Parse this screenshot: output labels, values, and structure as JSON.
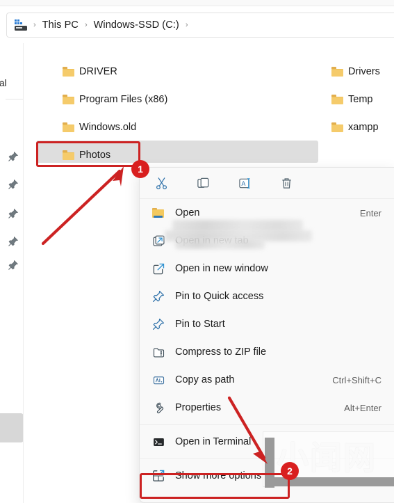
{
  "breadcrumb": {
    "icon": "this-pc-icon",
    "items": [
      "This PC",
      "Windows-SSD (C:)"
    ],
    "separator": "›"
  },
  "nav_pane": {
    "clipped_label": "onal",
    "pin_count": 5,
    "pin_icon": "pin-icon"
  },
  "file_list": {
    "left_column": [
      {
        "name": "DRIVER",
        "icon": "folder-icon"
      },
      {
        "name": "Program Files (x86)",
        "icon": "folder-icon"
      },
      {
        "name": "Windows.old",
        "icon": "folder-icon"
      },
      {
        "name": "Photos",
        "icon": "folder-icon",
        "selected": true
      }
    ],
    "right_column": [
      {
        "name": "Drivers",
        "icon": "folder-icon"
      },
      {
        "name": "Temp",
        "icon": "folder-icon"
      },
      {
        "name": "xampp",
        "icon": "folder-icon"
      }
    ]
  },
  "context_menu": {
    "toolbar": [
      {
        "name": "Cut",
        "icon": "scissors-icon"
      },
      {
        "name": "Copy",
        "icon": "copy-icon"
      },
      {
        "name": "Rename",
        "icon": "rename-icon"
      },
      {
        "name": "Delete",
        "icon": "trash-icon"
      }
    ],
    "items": [
      {
        "label": "Open",
        "accel": "Enter",
        "icon": "open-folder-icon"
      },
      {
        "label": "Open in new tab",
        "accel": "",
        "icon": "new-tab-icon"
      },
      {
        "label": "Open in new window",
        "accel": "",
        "icon": "new-window-icon"
      },
      {
        "label": "Pin to Quick access",
        "accel": "",
        "icon": "pin-icon"
      },
      {
        "label": "Pin to Start",
        "accel": "",
        "icon": "pin-icon"
      },
      {
        "label": "Compress to ZIP file",
        "accel": "",
        "icon": "zip-icon"
      },
      {
        "label": "Copy as path",
        "accel": "Ctrl+Shift+C",
        "icon": "copy-path-icon"
      },
      {
        "label": "Properties",
        "accel": "Alt+Enter",
        "icon": "wrench-icon"
      },
      {
        "label": "Open in Terminal",
        "accel": "",
        "icon": "terminal-icon"
      },
      {
        "label": "Show more options",
        "accel": "",
        "icon": "show-more-icon"
      }
    ]
  },
  "annotations": {
    "step1": {
      "badge": "1",
      "target": "Photos"
    },
    "step2": {
      "badge": "2",
      "target": "Show more options"
    },
    "highlight_color": "#cc2222"
  },
  "watermark": {
    "text": "小闻网"
  }
}
